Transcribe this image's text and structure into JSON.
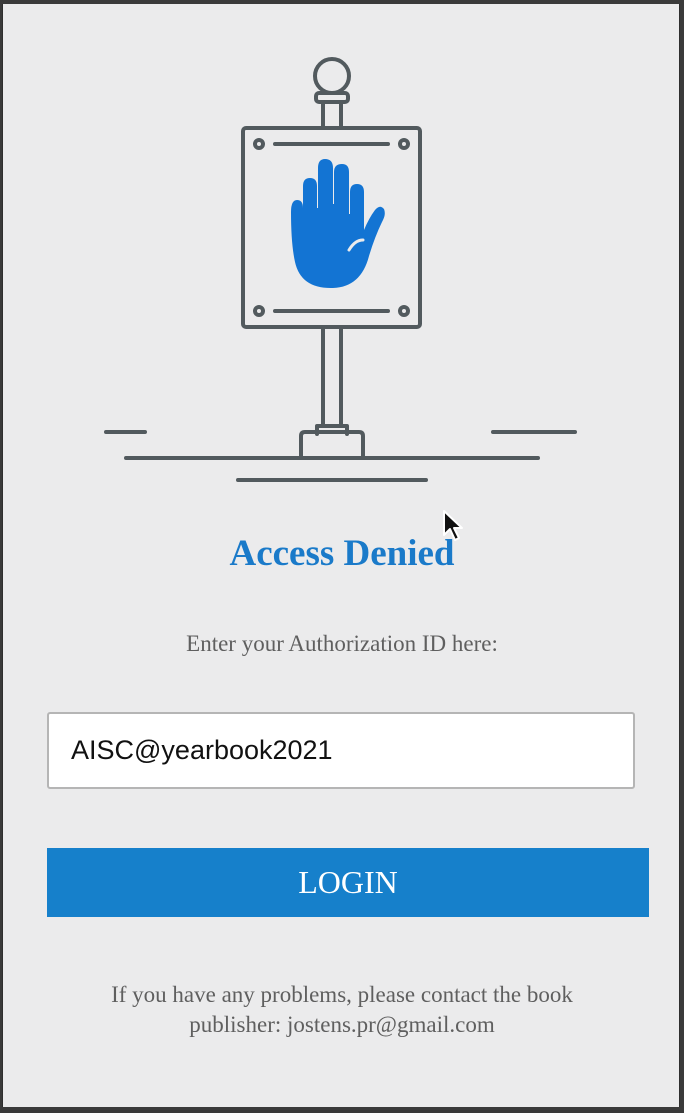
{
  "page": {
    "title": "Access Denied",
    "prompt": "Enter your Authorization ID here:",
    "auth_field": {
      "value": "AISC@yearbook2021",
      "placeholder": ""
    },
    "login_label": "LOGIN",
    "help_line1": "If you have any problems, please contact the book",
    "help_line2": "publisher: jostens.pr@gmail.com"
  },
  "icons": {
    "illustration": "stop-hand-sign-icon",
    "cursor": "mouse-pointer-icon"
  },
  "colors": {
    "accent": "#1680cb",
    "title": "#1a7ac9",
    "hand": "#1374d3",
    "line_art": "#525a5e",
    "background": "#ebebec"
  }
}
